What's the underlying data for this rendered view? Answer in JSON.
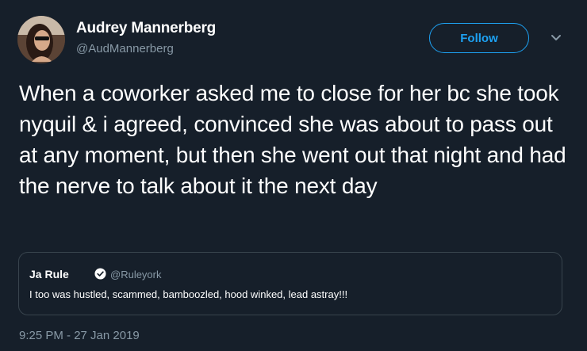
{
  "author": {
    "display_name": "Audrey Mannerberg",
    "handle": "@AudMannerberg",
    "avatar_icon": "profile-photo"
  },
  "actions": {
    "follow_label": "Follow",
    "menu_icon": "chevron-down-icon"
  },
  "tweet": {
    "text": "When a coworker asked me to close for her bc she took nyquil & i agreed, convinced she was about to pass out at any moment, but then she went out that night and had the nerve to talk about it the next day",
    "timestamp": "9:25 PM - 27 Jan 2019"
  },
  "quoted_tweet": {
    "display_name": "Ja Rule",
    "verified_icon": "verified-badge-icon",
    "handle": "@Ruleyork",
    "text": "I too was hustled, scammed, bamboozled, hood winked, lead astray!!!"
  },
  "colors": {
    "background": "#161f2a",
    "accent": "#1da1f2",
    "secondary_text": "#8899a6",
    "border": "#38444d"
  }
}
